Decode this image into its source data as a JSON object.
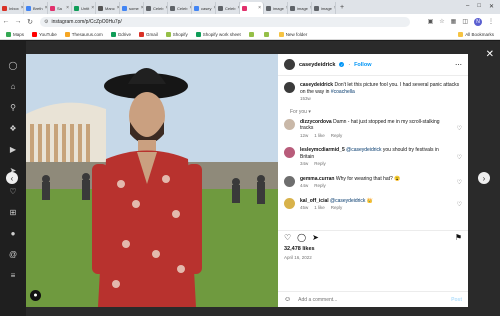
{
  "tabs": [
    {
      "label": "Inbox",
      "color": "#d93025"
    },
    {
      "label": "Breth",
      "color": "#4285f4"
    },
    {
      "label": "Sa",
      "color": "#e1306c"
    },
    {
      "label": "Untit",
      "color": "#0f9d58"
    },
    {
      "label": "Manc",
      "color": "#555555"
    },
    {
      "label": "some",
      "color": "#4285f4"
    },
    {
      "label": "Celeb",
      "color": "#5f6368"
    },
    {
      "label": "Celeb",
      "color": "#5f6368"
    },
    {
      "label": "casey",
      "color": "#4285f4"
    },
    {
      "label": "Celeb",
      "color": "#5f6368"
    },
    {
      "label": "",
      "color": "#e1306c",
      "active": true
    },
    {
      "label": "image",
      "color": "#5f6368"
    },
    {
      "label": "image",
      "color": "#5f6368"
    },
    {
      "label": "image",
      "color": "#5f6368"
    }
  ],
  "address": {
    "url": "instagram.com/p/CcZpO0Hu7p/"
  },
  "profile_initial": "N",
  "bookmarks": [
    {
      "label": "Maps",
      "color": "#34a853"
    },
    {
      "label": "YouTube",
      "color": "#ff0000"
    },
    {
      "label": "Thesaurus.com",
      "color": "#f6a623"
    },
    {
      "label": "Gdrive",
      "color": "#0f9d58"
    },
    {
      "label": "Gmail",
      "color": "#d93025"
    },
    {
      "label": "Shopify",
      "color": "#95bf47"
    },
    {
      "label": "Shopify work sheet",
      "color": "#0f9d58"
    },
    {
      "label": "",
      "color": "#95bf47"
    },
    {
      "label": "",
      "color": "#95bf47"
    },
    {
      "label": "New folder",
      "color": "#f6c342"
    }
  ],
  "bookmarks_all": "All Bookmarks",
  "post": {
    "username": "caseydeidrick",
    "follow_label": "Follow",
    "caption_user": "caseydeidrick",
    "caption_text": " Don't let this picture fool you. I had several panic attacks on the way in ",
    "caption_tag": "#coachella",
    "caption_time": "153w",
    "for_you": "For you",
    "comments": [
      {
        "user": "dizzycordova",
        "text": " Damn - hat just stopped me in my scroll-stalking tracks",
        "time": "12w",
        "likes": "1 like",
        "reply": "Reply",
        "avatar_color": "#c9b8a8"
      },
      {
        "user": "lesleymcdiarmid_5",
        "tag": "@caseydeidrick",
        "text": " you should try festivals in Britain",
        "time": "34w",
        "reply": "Reply",
        "avatar_color": "#b85c7a"
      },
      {
        "user": "gemma.curran",
        "text": " Why for wearing that hat? 😮",
        "time": "44w",
        "reply": "Reply",
        "avatar_color": "#6e6e6e"
      },
      {
        "user": "kal_off_icial",
        "tag": "@caseydeidrick",
        "text": " 👑",
        "time": "45w",
        "likes": "1 like",
        "reply": "Reply",
        "avatar_color": "#d8b24a"
      }
    ],
    "likes": "32,478 likes",
    "date": "April 16, 2022",
    "add_comment_placeholder": "Add a comment...",
    "post_label": "Post"
  }
}
